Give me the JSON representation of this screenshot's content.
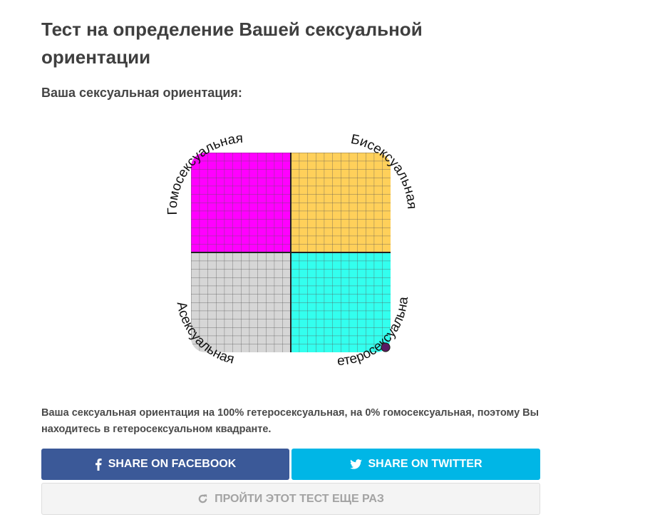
{
  "page": {
    "title": "Тест на определение Вашей сексуальной ориентации",
    "subtitle": "Ваша сексуальная ориентация:"
  },
  "chart": {
    "labels": {
      "top_left": "Гомосексуальная",
      "top_right": "Бисексуальная",
      "bottom_left": "Асексуальная",
      "bottom_right": "Гетеросексуальная"
    },
    "colors": {
      "top_left": "#ff00ff",
      "top_right": "#ffd05a",
      "bottom_left": "#d6d6d6",
      "bottom_right": "#33ffee",
      "marker": "#5a1a63"
    },
    "marker": {
      "heterosexual_percent": 100,
      "homosexual_percent": 0
    }
  },
  "result": {
    "text": "Ваша сексуальная ориентация на 100% гетеросексуальная, на 0% гомосексуальная, поэтому Вы находитесь в гетеросексуальном квадранте."
  },
  "buttons": {
    "facebook": {
      "label": "SHARE ON FACEBOOK",
      "icon": "facebook-icon"
    },
    "twitter": {
      "label": "SHARE ON TWITTER",
      "icon": "twitter-icon"
    },
    "retry": {
      "label": "ПРОЙТИ ЭТОТ ТЕСТ ЕЩЕ РАЗ",
      "icon": "refresh-icon"
    }
  }
}
